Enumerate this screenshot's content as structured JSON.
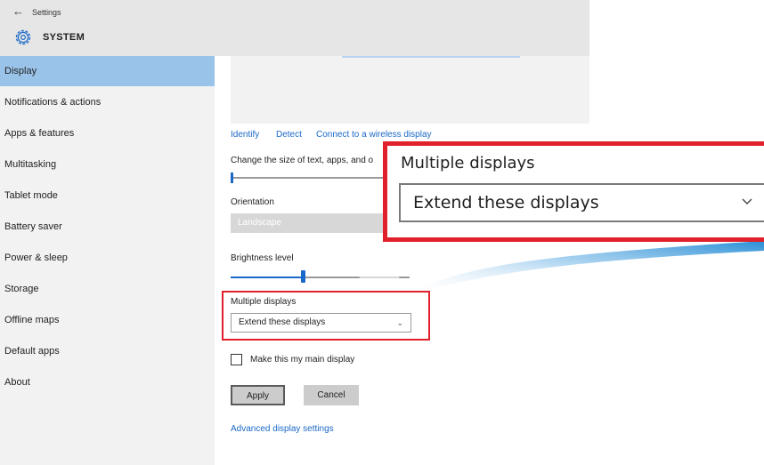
{
  "window": {
    "app_title": "Settings",
    "section_title": "SYSTEM"
  },
  "sidebar": {
    "items": [
      {
        "label": "Display"
      },
      {
        "label": "Notifications & actions"
      },
      {
        "label": "Apps & features"
      },
      {
        "label": "Multitasking"
      },
      {
        "label": "Tablet mode"
      },
      {
        "label": "Battery saver"
      },
      {
        "label": "Power & sleep"
      },
      {
        "label": "Storage"
      },
      {
        "label": "Offline maps"
      },
      {
        "label": "Default apps"
      },
      {
        "label": "About"
      }
    ],
    "selected_index": 0
  },
  "display": {
    "links": {
      "identify": "Identify",
      "detect": "Detect",
      "wireless": "Connect to a wireless display"
    },
    "scale_label": "Change the size of text, apps, and o",
    "orientation_label": "Orientation",
    "orientation_value": "Landscape",
    "brightness_label": "Brightness level",
    "brightness_level": 0.42,
    "multiple_displays_label": "Multiple displays",
    "multiple_displays_value": "Extend these displays",
    "main_display_label": "Make this my main display",
    "main_display_checked": false,
    "apply_label": "Apply",
    "cancel_label": "Cancel",
    "advanced_link": "Advanced display settings"
  },
  "callout": {
    "label": "Multiple displays",
    "value": "Extend these displays"
  },
  "colors": {
    "accent": "#1a68c7",
    "selected_bg": "#99c3e9",
    "highlight_red": "#e0202a",
    "sidebar_bg": "#f2f2f2",
    "titlebar_bg": "#e6e6e6"
  },
  "icons": {
    "back": "back-arrow-icon",
    "settings": "gear-icon",
    "dropdown": "chevron-down-icon"
  }
}
